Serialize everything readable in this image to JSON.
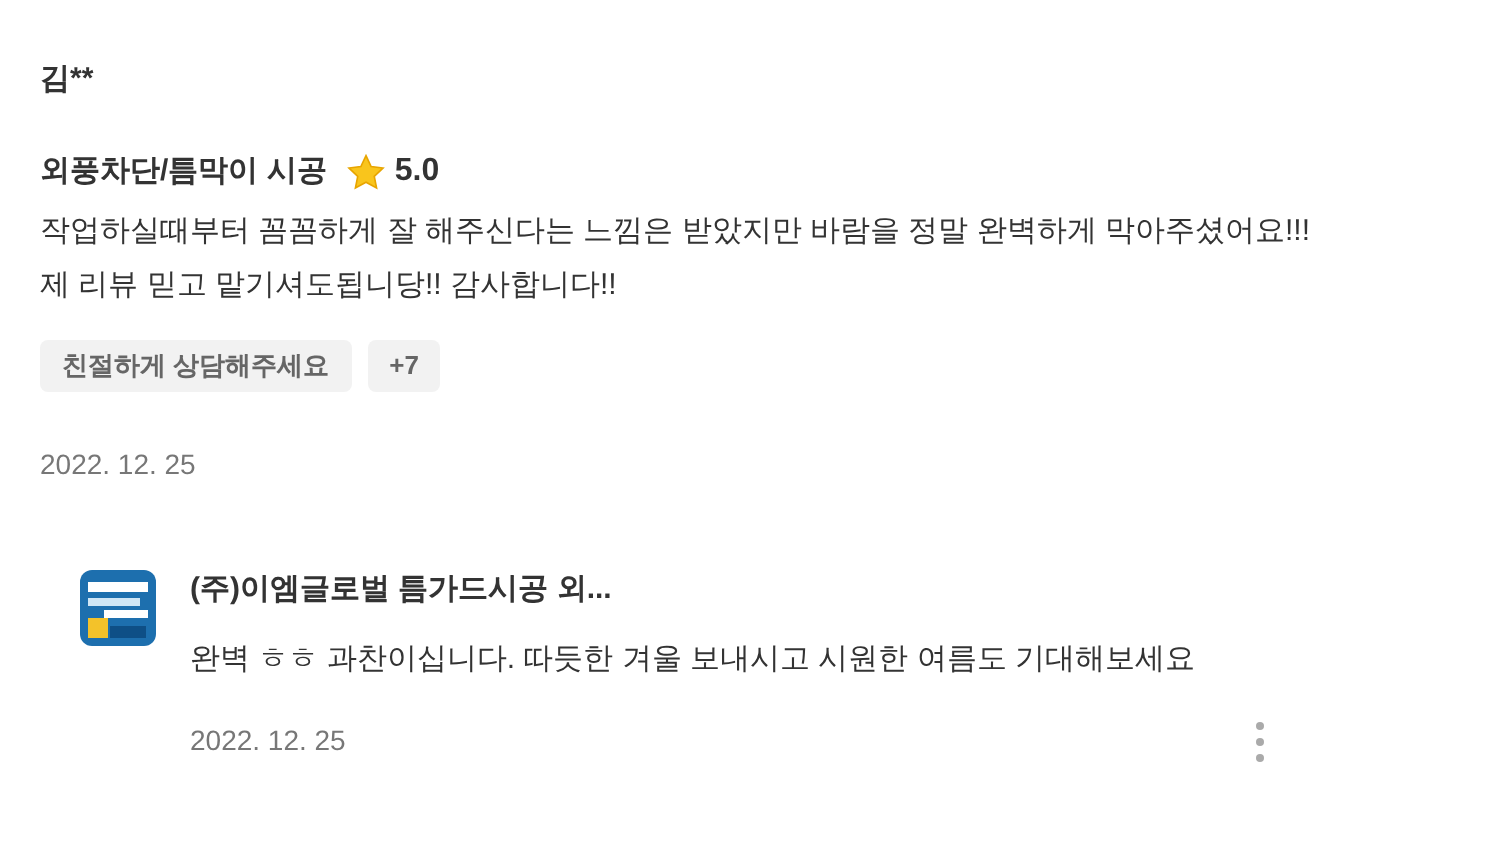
{
  "review": {
    "author": "김**",
    "service": "외풍차단/틈막이 시공",
    "rating": "5.0",
    "body": [
      "작업하실때부터 꼼꼼하게 잘 해주신다는 느낌은 받았지만 바람을 정말 완벽하게 막아주셨어요!!!",
      "제 리뷰 믿고 맡기셔도됩니당!! 감사합니다!!"
    ],
    "tags": [
      "친절하게 상담해주세요",
      "+7"
    ],
    "date": "2022. 12. 25"
  },
  "reply": {
    "author": "(주)이엠글로벌 틈가드시공 외...",
    "text": "완벽 ㅎㅎ 과찬이십니다. 따듯한 겨울 보내시고 시원한 여름도 기대해보세요",
    "date": "2022. 12. 25"
  }
}
